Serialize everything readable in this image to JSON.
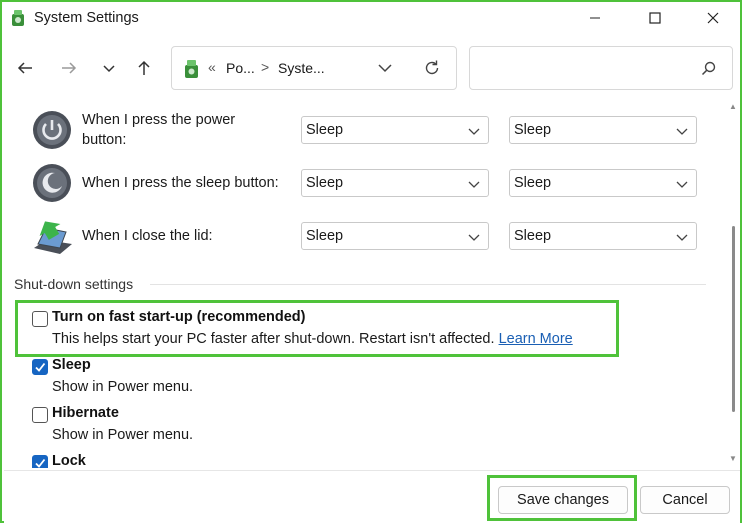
{
  "window": {
    "title": "System Settings",
    "minimize_glyph": "—",
    "maximize_glyph": "☐",
    "close_glyph": "✕"
  },
  "nav": {
    "breadcrumb_prefix": "«",
    "segments": [
      "Po...",
      "Syste..."
    ],
    "separator": ">",
    "search_placeholder": ""
  },
  "power_rows": [
    {
      "label_line1": "When I press the power",
      "label_line2": "button:",
      "on_battery": "Sleep",
      "plugged_in": "Sleep",
      "icon": "power-button-icon"
    },
    {
      "label_line1": "When I press the sleep button:",
      "label_line2": "",
      "on_battery": "Sleep",
      "plugged_in": "Sleep",
      "icon": "sleep-button-icon"
    },
    {
      "label_line1": "When I close the lid:",
      "label_line2": "",
      "on_battery": "Sleep",
      "plugged_in": "Sleep",
      "icon": "laptop-lid-icon"
    }
  ],
  "shutdown": {
    "section_title": "Shut-down settings",
    "options": [
      {
        "label": "Turn on fast start-up (recommended)",
        "desc": "This helps start your PC faster after shut-down. Restart isn't affected.",
        "link": "Learn More",
        "checked": false
      },
      {
        "label": "Sleep",
        "desc": "Show in Power menu.",
        "checked": true
      },
      {
        "label": "Hibernate",
        "desc": "Show in Power menu.",
        "checked": false
      },
      {
        "label": "Lock",
        "desc": "",
        "checked": true
      }
    ]
  },
  "buttons": {
    "save": "Save changes",
    "cancel": "Cancel"
  },
  "colors": {
    "highlight": "#4fc23a",
    "checkbox_checked": "#1665c2",
    "link": "#1a5fb4"
  }
}
